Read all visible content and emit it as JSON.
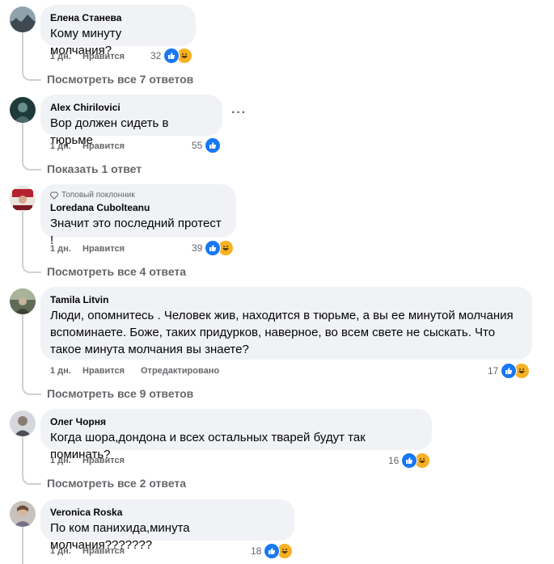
{
  "comments": [
    {
      "author": "Елена Станева",
      "text": "Кому минуту молчания?",
      "age": "1 дн.",
      "like_label": "Нравится",
      "reaction_count": "32",
      "replies_label": "Посмотреть все 7 ответов"
    },
    {
      "author": "Alex Chirilovici",
      "text": "Вор должен сидеть в тюрьме",
      "age": "1 дн.",
      "like_label": "Нравится",
      "reaction_count": "55",
      "replies_label": "Показать 1 ответ",
      "more": "···"
    },
    {
      "badge": "Топовый поклонник",
      "author": "Loredana Cubolteanu",
      "text": "Значит это последний протест !",
      "age": "1 дн.",
      "like_label": "Нравится",
      "reaction_count": "39",
      "replies_label": "Посмотреть все 4 ответа"
    },
    {
      "author": "Tamila Litvin",
      "text_lines": [
        "Люди, опомнитесь . Человек жив, находится в тюрьме, а вы ее минутой молчания",
        "вспоминаете. Боже, таких придурков, наверное, во всем свете не сыскать. Что",
        "такое минута молчания вы знаете?"
      ],
      "age": "1 дн.",
      "like_label": "Нравится",
      "edited_label": "Отредактировано",
      "reaction_count": "17",
      "replies_label": "Посмотреть все 9 ответов"
    },
    {
      "author": "Олег Чорня",
      "text": "Когда шора,дондона и всех остальных тварей будут так поминать?",
      "age": "1 дн.",
      "like_label": "Нравится",
      "reaction_count": "16",
      "replies_label": "Посмотреть все 2 ответа"
    },
    {
      "author": "Veronica Roska",
      "text": "По ком панихида,минута молчания???????",
      "age": "1 дн.",
      "like_label": "Нравится",
      "reaction_count": "18"
    }
  ],
  "colors": {
    "bubble": "#f0f2f5",
    "meta_text": "#65676b",
    "like_blue": "#1877f2",
    "haha_yellow": "#f7b125"
  }
}
